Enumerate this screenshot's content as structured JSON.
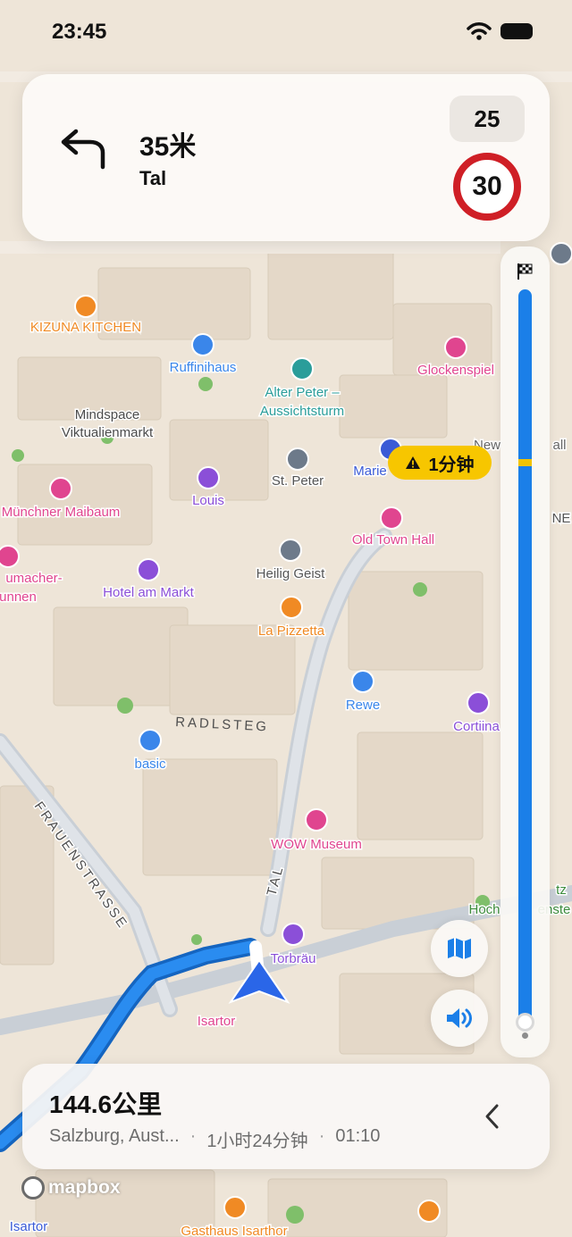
{
  "status_bar": {
    "time": "23:45"
  },
  "banner": {
    "distance": "35米",
    "street": "Tal",
    "current_speed": "25",
    "speed_limit": "30",
    "maneuver_icon": "turn-left-arrow-icon"
  },
  "traffic": {
    "label": "1分钟",
    "icon": "warning-icon",
    "color": "#f7c600"
  },
  "route_progress": {
    "remaining_fraction": 1.0,
    "icon": "checkered-flag-icon"
  },
  "buttons": {
    "overview": "map-icon",
    "audio": "speaker-icon"
  },
  "trip": {
    "total_distance": "144.6公里",
    "destination": "Salzburg, Aust...",
    "duration": "1小时24分钟",
    "eta": "01:10",
    "separator": "·"
  },
  "attribution": {
    "logo": "mapbox"
  },
  "map": {
    "pois": [
      {
        "name": "KIZUNA KITCHEN",
        "kind": "restaurant"
      },
      {
        "name": "Ruffinihaus",
        "kind": "shop"
      },
      {
        "name": "Alter Peter – Aussichtsturm",
        "kind": "viewpoint"
      },
      {
        "name": "Glockenspiel",
        "kind": "attraction"
      },
      {
        "name": "Mindspace Viktualienmarkt",
        "kind": "place"
      },
      {
        "name": "Louis",
        "kind": "hotel"
      },
      {
        "name": "St. Peter",
        "kind": "church"
      },
      {
        "name": "Marie",
        "kind": "transit"
      },
      {
        "name": "New",
        "kind": "place"
      },
      {
        "name": "all",
        "kind": "place"
      },
      {
        "name": "Münchner Maibaum",
        "kind": "attraction"
      },
      {
        "name": "Old Town Hall",
        "kind": "attraction"
      },
      {
        "name": "umacher-",
        "kind": "attraction"
      },
      {
        "name": "unnen",
        "kind": "attraction"
      },
      {
        "name": "Hotel am Markt",
        "kind": "hotel"
      },
      {
        "name": "Heilig Geist",
        "kind": "church"
      },
      {
        "name": "La Pizzetta",
        "kind": "restaurant"
      },
      {
        "name": "Rewe",
        "kind": "grocery"
      },
      {
        "name": "Cortiina",
        "kind": "hotel"
      },
      {
        "name": "basic",
        "kind": "grocery"
      },
      {
        "name": "WOW Museum",
        "kind": "attraction"
      },
      {
        "name": "Torbräu",
        "kind": "hotel"
      },
      {
        "name": "Isartor",
        "kind": "attraction"
      },
      {
        "name": "Hoch",
        "kind": "place"
      },
      {
        "name": "tz",
        "kind": "place"
      },
      {
        "name": "enste",
        "kind": "place"
      },
      {
        "name": "NE",
        "kind": "place"
      },
      {
        "name": "Gasthaus Isarthor",
        "kind": "restaurant"
      },
      {
        "name": "Isartor",
        "kind": "transit"
      }
    ],
    "streets": [
      "RADLSTEG",
      "FRAUENSTRASSE",
      "TAL"
    ],
    "colors": {
      "restaurant": "#f08a24",
      "attraction": "#e0458f",
      "hotel": "#8b4fd8",
      "shop": "#3a86ea",
      "church": "#6d7a8a",
      "route": "#1b7fe8"
    }
  }
}
